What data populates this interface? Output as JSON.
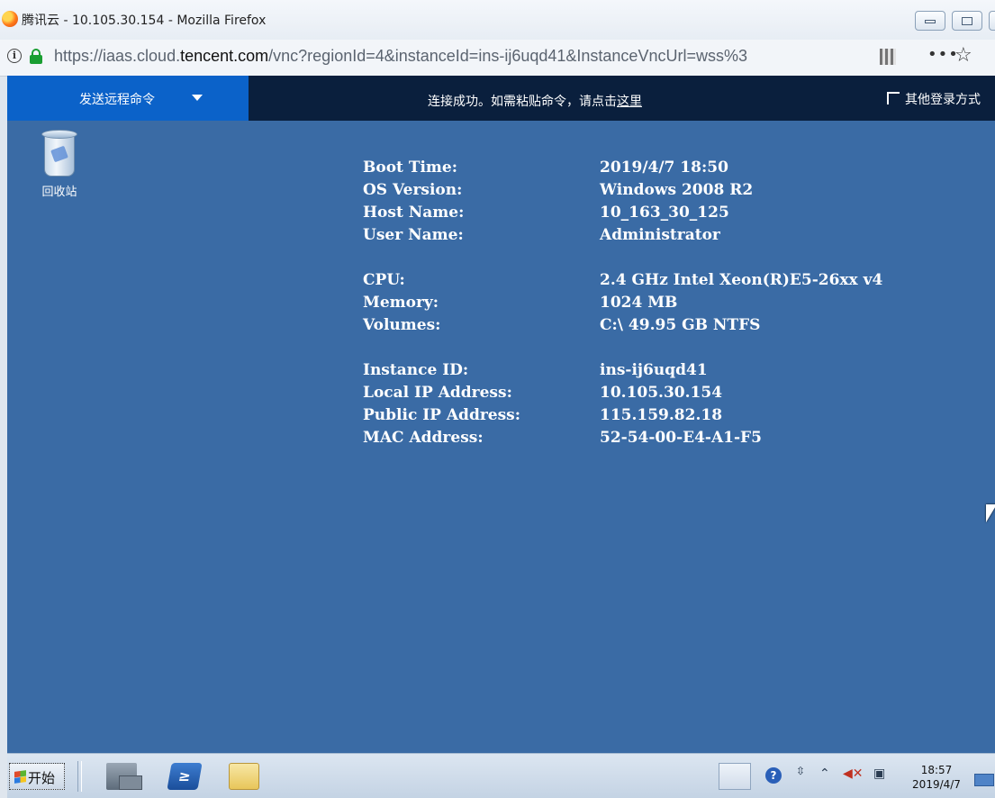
{
  "window": {
    "title": "腾讯云 - 10.105.30.154 - Mozilla Firefox"
  },
  "address_bar": {
    "url_prefix": "https://iaas.cloud.",
    "url_domain": "tencent.com",
    "url_suffix": "/vnc?regionId=4&instanceId=ins-ij6uqd41&InstanceVncUrl=wss%3",
    "more_label": "•••",
    "star_label": "☆"
  },
  "vnc_toolbar": {
    "send_command_label": "发送远程命令",
    "status_text": "连接成功。如需粘贴命令，请点击",
    "status_link": "这里",
    "other_login_label": "其他登录方式"
  },
  "desktop": {
    "recycle_bin_label": "回收站",
    "bginfo": [
      {
        "key": "Boot Time:",
        "value": "2019/4/7 18:50"
      },
      {
        "key": "OS Version:",
        "value": "Windows 2008 R2"
      },
      {
        "key": "Host Name:",
        "value": "10_163_30_125"
      },
      {
        "key": "User Name:",
        "value": "Administrator"
      },
      {
        "key": "CPU:",
        "value": "2.4 GHz Intel Xeon(R)E5-26xx v4"
      },
      {
        "key": "Memory:",
        "value": "1024 MB"
      },
      {
        "key": "Volumes:",
        "value": "C:\\ 49.95 GB NTFS"
      },
      {
        "key": "Instance ID:",
        "value": "ins-ij6uqd41"
      },
      {
        "key": "Local IP Address:",
        "value": "10.105.30.154"
      },
      {
        "key": "Public IP Address:",
        "value": "115.159.82.18"
      },
      {
        "key": "MAC Address:",
        "value": "52-54-00-E4-A1-F5"
      }
    ]
  },
  "taskbar": {
    "start_label": "开始",
    "clock_time": "18:57",
    "clock_date": "2019/4/7"
  },
  "icons": {
    "help": "?",
    "powershell": "≥"
  }
}
